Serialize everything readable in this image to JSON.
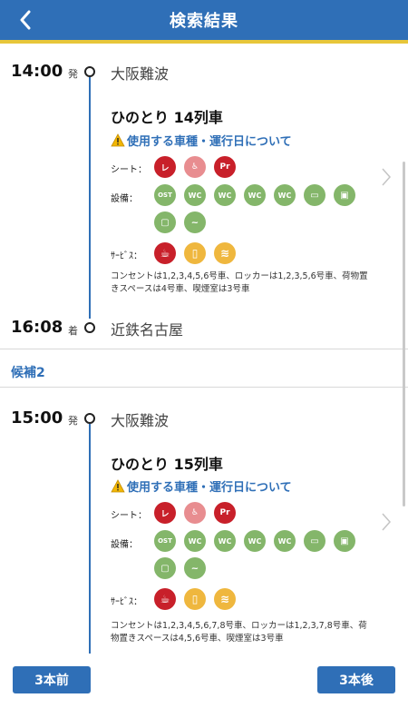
{
  "header": {
    "title": "検索結果"
  },
  "routes": [
    {
      "dep_time": "14:00",
      "dep_mark": "発",
      "dep_station": "大阪難波",
      "train": "ひのとり 14列車",
      "notice": "使用する車種・運行日について",
      "seat_label": "シート：",
      "facility_label": "設備：",
      "service_label": "ｻｰﾋﾞｽ：",
      "note": "コンセントは1,2,3,4,5,6号車、ロッカーは1,2,3,5,6号車、荷物置きスペースは4号車、喫煙室は3号車",
      "arr_time": "16:08",
      "arr_mark": "着",
      "arr_station": "近鉄名古屋"
    },
    {
      "candidate_label": "候補2",
      "dep_time": "15:00",
      "dep_mark": "発",
      "dep_station": "大阪難波",
      "train": "ひのとり 15列車",
      "notice": "使用する車種・運行日について",
      "seat_label": "シート：",
      "facility_label": "設備：",
      "service_label": "ｻｰﾋﾞｽ：",
      "note": "コンセントは1,2,3,4,5,6,7,8号車、ロッカーは1,2,3,7,8号車、荷物置きスペースは4,5,6号車、喫煙室は3号車"
    }
  ],
  "icons": {
    "seat_text": [
      "レ",
      "♿",
      "Pr"
    ],
    "facility_text": [
      "OST",
      "WC",
      "WC",
      "WC",
      "WC",
      "▭",
      "▣",
      "▢",
      "~"
    ],
    "service_text": [
      "☕",
      "▯",
      "≋"
    ]
  },
  "footer": {
    "prev_label": "3本前",
    "next_label": "3本後"
  },
  "colors": {
    "primary": "#2f6fb7",
    "stripe": "#e7c63a",
    "seat_red": "#c8202a",
    "facility_green": "#84b66a",
    "service_yellow": "#efb73e"
  }
}
